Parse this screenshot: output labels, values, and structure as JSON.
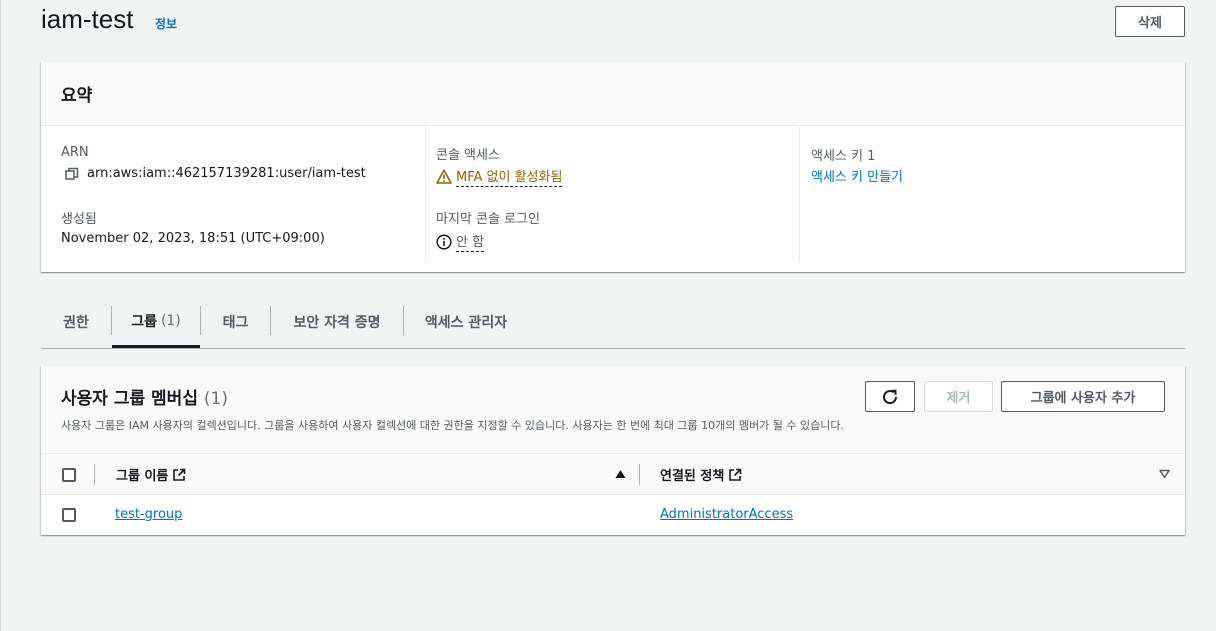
{
  "header": {
    "title": "iam-test",
    "info_link": "정보",
    "delete_label": "삭제"
  },
  "summary": {
    "title": "요약",
    "arn_label": "ARN",
    "arn_value": "arn:aws:iam::462157139281:user/iam-test",
    "created_label": "생성됨",
    "created_value": "November 02, 2023, 18:51 (UTC+09:00)",
    "console_access_label": "콘솔 액세스",
    "console_access_value": "MFA 없이 활성화됨",
    "last_login_label": "마지막 콘솔 로그인",
    "last_login_value": "안 함",
    "access_key_label": "액세스 키 1",
    "access_key_link": "액세스 키 만들기"
  },
  "tabs": [
    {
      "label": "권한"
    },
    {
      "label": "그룹",
      "count": "(1)"
    },
    {
      "label": "태그"
    },
    {
      "label": "보안 자격 증명"
    },
    {
      "label": "액세스 관리자"
    }
  ],
  "groups": {
    "title": "사용자 그룹 멤버십",
    "count": "(1)",
    "description": "사용자 그룹은 IAM 사용자의 컬렉션입니다. 그룹을 사용하여 사용자 컬렉션에 대한 권한을 지정할 수 있습니다. 사용자는 한 번에 최대 그룹 10개의 멤버가 될 수 있습니다.",
    "remove_label": "제거",
    "add_label": "그룹에 사용자 추가",
    "columns": [
      "그룹 이름",
      "연결된 정책"
    ],
    "rows": [
      {
        "group_name": "test-group",
        "policy": "AdministratorAccess"
      }
    ]
  },
  "colors": {
    "link": "#0073bb",
    "warning": "#8d6605",
    "text": "#16191f",
    "muted": "#545b64"
  }
}
